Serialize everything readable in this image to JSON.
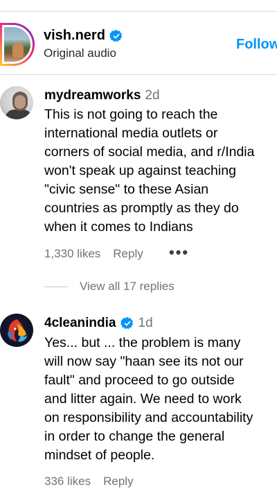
{
  "header": {
    "username": "vish.nerd",
    "subtitle": "Original audio",
    "follow_label": "Follow"
  },
  "comments": [
    {
      "username": "mydreamworks",
      "age": "2d",
      "verified": false,
      "lines": [
        "This is not going to reach the",
        "international media outlets or",
        "corners of social media, and r/India",
        "won't speak up against teaching",
        "\"civic sense\" to these Asian",
        "countries as promptly as they do",
        "when it comes to Indians"
      ],
      "likes": "1,330 likes",
      "reply_label": "Reply",
      "more_icon": "•••",
      "view_replies": "View all 17 replies"
    },
    {
      "username": "4cleanindia",
      "age": "1d",
      "verified": true,
      "lines": [
        "Yes... but ... the problem is many",
        "will now say \"haan see its not our",
        "fault\" and proceed to go outside",
        "and litter again. We need to work",
        "on responsibility and accountability",
        "in order to change the general",
        "mindset of people."
      ],
      "likes": "336 likes",
      "reply_label": "Reply"
    }
  ],
  "colors": {
    "accent": "#0095f6",
    "secondary_text": "#737373",
    "divider": "#dbdbdb"
  }
}
